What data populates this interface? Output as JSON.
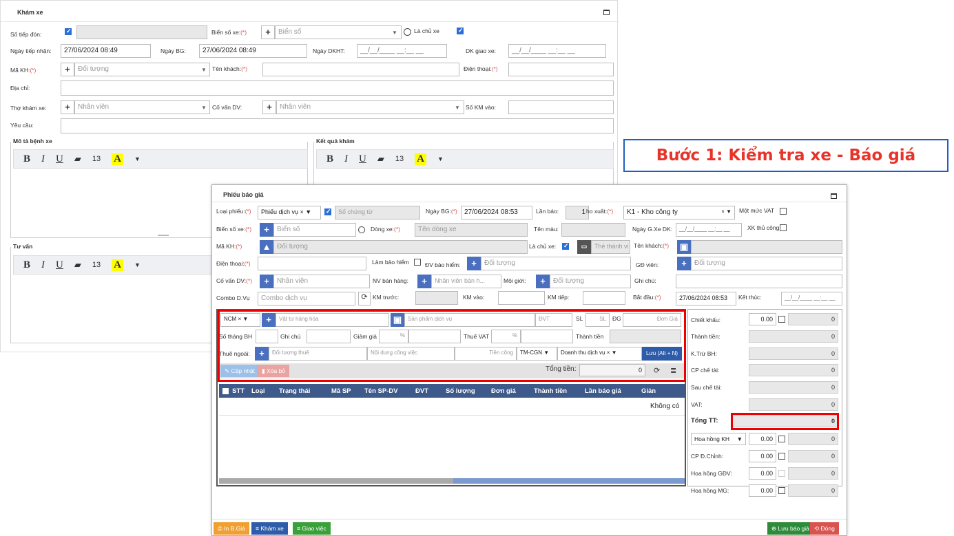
{
  "kham_xe": {
    "title": "Khám xe",
    "so_tiep_don": "Số tiếp đón:",
    "bien_so_label": "Biển số xe:",
    "bien_so_ph": "Biển số",
    "la_chu_xe": "Là chủ xe",
    "ngay_tiep_nhan": "Ngày tiếp nhận:",
    "ngay_tiep_nhan_val": "27/06/2024 08:49",
    "ngay_bg": "Ngày BG:",
    "ngay_bg_val": "27/06/2024 08:49",
    "ngay_dkht": "Ngày DKHT:",
    "date_mask": "__/__/____ __:__ __",
    "dk_giao_xe": "DK giao xe:",
    "ma_kh": "Mã KH:",
    "doi_tuong": "Đối tượng",
    "ten_khach": "Tên khách:",
    "dien_thoai": "Điện thoại:",
    "dia_chi": "Địa chỉ:",
    "tho_kham_xe": "Thợ khám xe:",
    "nhan_vien": "Nhân viên",
    "co_van_dv": "Cố vấn DV:",
    "so_km_vao": "Số KM vào:",
    "yeu_cau": "Yêu cầu:",
    "mo_ta": "Mô tả bệnh xe",
    "ket_qua": "Kết quả khám",
    "tu_van": "Tư vấn",
    "font_size": "13"
  },
  "annotation": "Bước 1: Kiểm tra xe - Báo giá",
  "phieu": {
    "title": "Phiếu báo giá",
    "loai_phieu": "Loại phiếu:",
    "loai_phieu_val": "Phiếu dịch vụ",
    "so_chung_tu": "Số chứng từ",
    "ngay_bg": "Ngày BG:",
    "ngay_bg_val": "27/06/2024 08:53",
    "lan_bao": "Lần báo:",
    "lan_bao_val": "1",
    "kho_xuat": "ho xuất:",
    "kho_val": "K1 - Kho công ty",
    "mot_muc_vat": "Một mức VAT",
    "bien_so": "Biển số xe:",
    "bien_so_ph": "Biển số",
    "dong_xe": "Dòng xe:",
    "dong_xe_ph": "Tên dòng xe",
    "ten_mau": "Tên màu:",
    "ngay_gxe": "Ngày G.Xe DK:",
    "xk_thu_cong": "XK thủ công",
    "ma_kh": "Mã KH:",
    "doi_tuong": "Đối tượng",
    "la_chu_xe": "Là chủ xe:",
    "the_thanh_vien": "Thẻ thành vi",
    "ten_khach": "Tên khách:",
    "dien_thoai": "Điện thoại:",
    "lam_bao_hiem": "Làm bảo hiểm",
    "dv_bao_hiem": "ĐV bảo hiểm:",
    "gd_vien": "GĐ viên:",
    "co_van": "Cố vấn DV:",
    "nhan_vien": "Nhân viên",
    "nv_ban_hang": "NV bán hàng:",
    "nv_ban_hang_ph": "Nhân viên bán h...",
    "moi_gioi": "Môi giới:",
    "ghi_chu": "Ghi chú:",
    "combo": "Combo D.Vụ",
    "combo_ph": "Combo dịch vụ",
    "km_truoc": "KM trước:",
    "km_vao": "KM vào:",
    "km_tiep": "KM tiếp:",
    "bat_dau": "Bắt đầu:",
    "bat_dau_val": "27/06/2024 08:53",
    "ket_thuc": "Kết thúc:",
    "date_mask": "__/__/____ __:__ __"
  },
  "entry": {
    "ncm": "NCM",
    "vat_tu": "Vật tư hàng hóa",
    "san_pham": "Sản phẩm dịch vụ",
    "dvt": "ĐVT",
    "sl": "SL",
    "sl_ph": "SL",
    "dg": "ĐG",
    "don_gia": "Đơn Giá",
    "so_thang_bh": "Số tháng BH",
    "ghi_chu": "Ghi chú",
    "giam_gia": "Giảm giá",
    "pct": "%",
    "thue_vat": "Thuế VAT",
    "thanh_tien": "Thành tiền",
    "thue_ngoai": "Thuê ngoài:",
    "doi_tuong_thue": "Đối tượng thuê",
    "noi_dung": "Nội dung công việc",
    "tien_cong": "Tiền công",
    "tm_cgn": "TM-CGN",
    "doanh_thu": "Doanh thu dịch vụ",
    "luu": "Lưu (Alt + N)",
    "cap_nhat": "Cập nhật",
    "xoa_bo": "Xóa bỏ",
    "tong_tien": "Tổng tiền:",
    "tong_tien_val": "0"
  },
  "table": {
    "headers": [
      "STT",
      "Loại",
      "Trạng thái",
      "Mã SP",
      "Tên SP-DV",
      "ĐVT",
      "Số lượng",
      "Đơn giá",
      "Thành tiền",
      "Lần báo giá",
      "Giản"
    ],
    "empty": "Không có"
  },
  "summary": {
    "chiet_khau": "Chiết khấu:",
    "thanh_tien": "Thành tiền:",
    "ktru_bh": "K.Trừ BH:",
    "cp_che_tai": "CP chế tài:",
    "sau_che_tai": "Sau chế tài:",
    "vat": "VAT:",
    "tong_tt": "Tổng TT:",
    "hoa_hong_kh": "Hoa hồng KH",
    "cp_dchinh": "CP Đ.Chỉnh:",
    "hoa_hong_gdv": "Hoa hồng GĐV:",
    "hoa_hong_mg": "Hoa hồng MG:",
    "pct_val": "0.00",
    "zero": "0"
  },
  "footer": {
    "in_bgia": "In B.Giá",
    "kham_xe": "Khám xe",
    "giao_viec": "Giao việc",
    "luu_bao_gia": "Lưu báo giá",
    "dong": "Đóng"
  }
}
